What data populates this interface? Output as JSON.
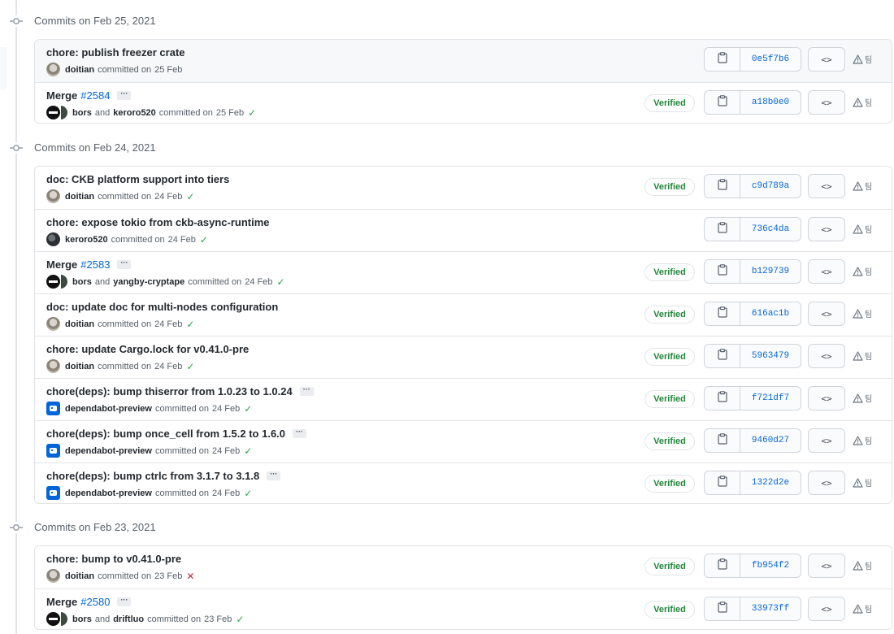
{
  "groups": [
    {
      "title": "Commits on Feb 25, 2021",
      "commits": [
        {
          "message": "chore: publish freezer crate",
          "pr": "",
          "ellipsis": false,
          "avatar": "doitian",
          "authors": [
            "doitian"
          ],
          "date": "25 Feb",
          "status": "none",
          "verified": "",
          "sha": "0e5f7b6",
          "highlight": true
        },
        {
          "message": "Merge",
          "pr": "#2584",
          "ellipsis": true,
          "avatar": "bors-pair",
          "authors": [
            "bors",
            "keroro520"
          ],
          "date": "25 Feb",
          "status": "success",
          "verified": "Verified",
          "sha": "a18b0e0",
          "highlight": false
        }
      ]
    },
    {
      "title": "Commits on Feb 24, 2021",
      "commits": [
        {
          "message": "doc: CKB platform support into tiers",
          "pr": "",
          "ellipsis": false,
          "avatar": "doitian",
          "authors": [
            "doitian"
          ],
          "date": "24 Feb",
          "status": "success",
          "verified": "Verified",
          "sha": "c9d789a",
          "highlight": false
        },
        {
          "message": "chore: expose tokio from ckb-async-runtime",
          "pr": "",
          "ellipsis": false,
          "avatar": "keroro",
          "authors": [
            "keroro520"
          ],
          "date": "24 Feb",
          "status": "success",
          "verified": "",
          "sha": "736c4da",
          "highlight": false
        },
        {
          "message": "Merge",
          "pr": "#2583",
          "ellipsis": true,
          "avatar": "bors-pair",
          "authors": [
            "bors",
            "yangby-cryptape"
          ],
          "date": "24 Feb",
          "status": "success",
          "verified": "Verified",
          "sha": "b129739",
          "highlight": false
        },
        {
          "message": "doc: update doc for multi-nodes configuration",
          "pr": "",
          "ellipsis": false,
          "avatar": "doitian",
          "authors": [
            "doitian"
          ],
          "date": "24 Feb",
          "status": "success",
          "verified": "Verified",
          "sha": "616ac1b",
          "highlight": false
        },
        {
          "message": "chore: update Cargo.lock for v0.41.0-pre",
          "pr": "",
          "ellipsis": false,
          "avatar": "doitian",
          "authors": [
            "doitian"
          ],
          "date": "24 Feb",
          "status": "success",
          "verified": "Verified",
          "sha": "5963479",
          "highlight": false
        },
        {
          "message": "chore(deps): bump thiserror from 1.0.23 to 1.0.24",
          "pr": "",
          "ellipsis": true,
          "avatar": "dependabot",
          "authors": [
            "dependabot-preview"
          ],
          "date": "24 Feb",
          "status": "success",
          "verified": "Verified",
          "sha": "f721df7",
          "highlight": false
        },
        {
          "message": "chore(deps): bump once_cell from 1.5.2 to 1.6.0",
          "pr": "",
          "ellipsis": true,
          "avatar": "dependabot",
          "authors": [
            "dependabot-preview"
          ],
          "date": "24 Feb",
          "status": "success",
          "verified": "Verified",
          "sha": "9460d27",
          "highlight": false
        },
        {
          "message": "chore(deps): bump ctrlc from 3.1.7 to 3.1.8",
          "pr": "",
          "ellipsis": true,
          "avatar": "dependabot",
          "authors": [
            "dependabot-preview"
          ],
          "date": "24 Feb",
          "status": "success",
          "verified": "Verified",
          "sha": "1322d2e",
          "highlight": false
        }
      ]
    },
    {
      "title": "Commits on Feb 23, 2021",
      "commits": [
        {
          "message": "chore: bump to v0.41.0-pre",
          "pr": "",
          "ellipsis": false,
          "avatar": "doitian",
          "authors": [
            "doitian"
          ],
          "date": "23 Feb",
          "status": "failure",
          "verified": "Verified",
          "sha": "fb954f2",
          "highlight": false
        },
        {
          "message": "Merge",
          "pr": "#2580",
          "ellipsis": true,
          "avatar": "bors-pair",
          "authors": [
            "bors",
            "driftluo"
          ],
          "date": "23 Feb",
          "status": "success",
          "verified": "Verified",
          "sha": "33973ff",
          "highlight": false
        }
      ]
    }
  ],
  "labels": {
    "committed_on": "committed on",
    "and": "and",
    "ellipsis": "···",
    "browse": "<>",
    "tools_text": "팀",
    "check": "✓",
    "cross": "✕"
  },
  "colors": {
    "link": "#0366d6",
    "success": "#28a745",
    "failure": "#cb2431",
    "verified": "#22863a",
    "border": "#e1e4e8"
  },
  "icons": {
    "group_node": "git-commit-icon",
    "copy": "clipboard-icon",
    "browse": "code-icon",
    "tools": "alert-icon"
  }
}
